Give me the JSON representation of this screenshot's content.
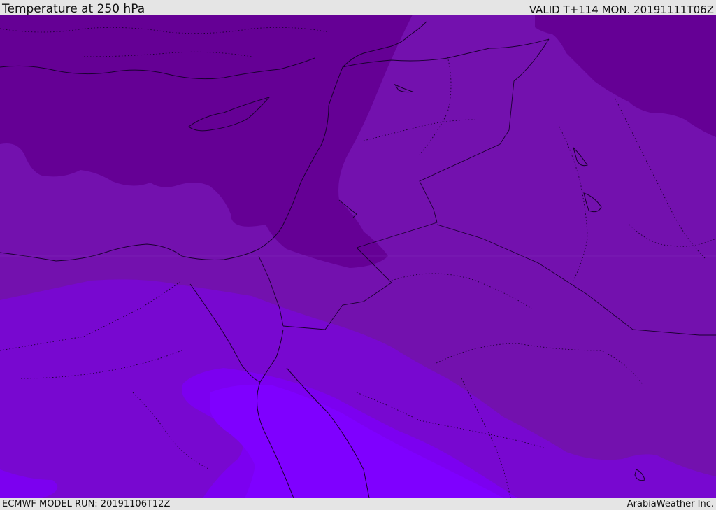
{
  "header": {
    "title": "Temperature at 250 hPa",
    "valid": "VALID T+114 MON. 20191111T06Z"
  },
  "footer": {
    "model_run": "ECMWF MODEL RUN: 20191106T12Z",
    "credit": "ArabiaWeather Inc."
  },
  "map": {
    "colors": {
      "coldest": "#650095",
      "cold": "#7311ae",
      "mid": "#7808d0",
      "warm": "#7c00f0",
      "warmest": "#7f00ff",
      "lines": "#1a0030"
    }
  }
}
